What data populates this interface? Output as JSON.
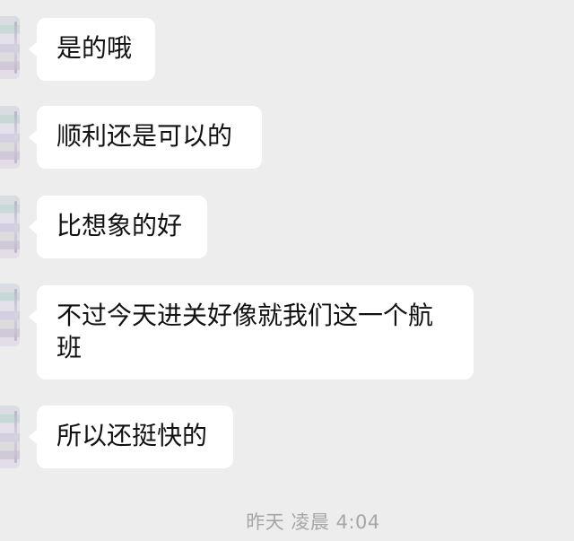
{
  "messages": [
    {
      "text": "是的哦"
    },
    {
      "text": "顺利还是可以的"
    },
    {
      "text": "比想象的好"
    },
    {
      "text": "不过今天进关好像就我们这一个航\n班"
    },
    {
      "text": "所以还挺快的"
    }
  ],
  "timestamp": "昨天 凌晨 4:04",
  "colors": {
    "background": "#ededed",
    "bubble": "#ffffff",
    "text": "#111111",
    "timestamp": "#a6a6a6"
  }
}
